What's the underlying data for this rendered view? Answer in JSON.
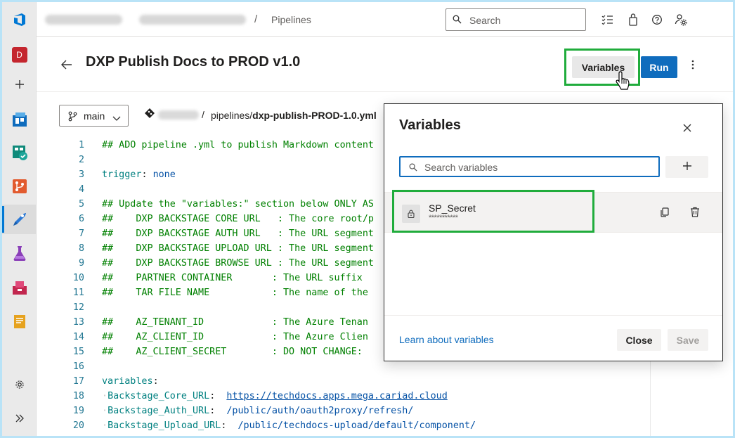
{
  "rail": {
    "avatar_letter": "D",
    "items": [
      "azure-devops-logo",
      "avatar",
      "add",
      "boards",
      "test-plans",
      "repos",
      "pipelines",
      "test",
      "artifacts",
      "wiki",
      "settings",
      "expand"
    ]
  },
  "topbar": {
    "separator": "/",
    "current": "Pipelines",
    "search_placeholder": "Search"
  },
  "header": {
    "title": "DXP Publish Docs to PROD v1.0",
    "variables_label": "Variables",
    "run_label": "Run"
  },
  "file": {
    "branch": "main",
    "path_separator": "/",
    "path_prefix": "pipelines/",
    "filename": "dxp-publish-PROD-1.0.yml"
  },
  "code": {
    "lines": [
      {
        "n": "1",
        "text": "## ADO pipeline .yml to publish Markdown content"
      },
      {
        "n": "2",
        "text": ""
      },
      {
        "n": "3",
        "key": "trigger",
        "value": "none"
      },
      {
        "n": "4",
        "text": ""
      },
      {
        "n": "5",
        "text": "## Update the \"variables:\" section below ONLY AS"
      },
      {
        "n": "6",
        "text": "##    DXP BACKSTAGE CORE URL   : The core root/p"
      },
      {
        "n": "7",
        "text": "##    DXP BACKSTAGE AUTH URL   : The URL segment"
      },
      {
        "n": "8",
        "text": "##    DXP BACKSTAGE UPLOAD URL : The URL segment"
      },
      {
        "n": "9",
        "text": "##    DXP BACKSTAGE BROWSE URL : The URL segment"
      },
      {
        "n": "10",
        "text": "##    PARTNER CONTAINER       : The URL suffix"
      },
      {
        "n": "11",
        "text": "##    TAR FILE NAME           : The name of the"
      },
      {
        "n": "12",
        "text": ""
      },
      {
        "n": "13",
        "text": "##    AZ_TENANT_ID            : The Azure Tenan"
      },
      {
        "n": "14",
        "text": "##    AZ_CLIENT_ID            : The Azure Clien"
      },
      {
        "n": "15",
        "text": "##    AZ_CLIENT_SECRET        : DO NOT CHANGE:"
      },
      {
        "n": "16",
        "text": ""
      },
      {
        "n": "17",
        "key": "variables",
        "value": ""
      },
      {
        "n": "18",
        "key": "Backstage_Core_URL",
        "value": "https://techdocs.apps.mega.cariad.cloud",
        "indent": true,
        "link": true
      },
      {
        "n": "19",
        "key": "Backstage_Auth_URL",
        "value": "/public/auth/oauth2proxy/refresh/",
        "indent": true
      },
      {
        "n": "20",
        "key": "Backstage_Upload_URL",
        "value": "/public/techdocs-upload/default/component/",
        "indent": true
      }
    ]
  },
  "dialog": {
    "title": "Variables",
    "search_placeholder": "Search variables",
    "variables": [
      {
        "name": "SP_Secret",
        "value": "***********"
      }
    ],
    "learn_link": "Learn about variables",
    "close_label": "Close",
    "save_label": "Save"
  }
}
